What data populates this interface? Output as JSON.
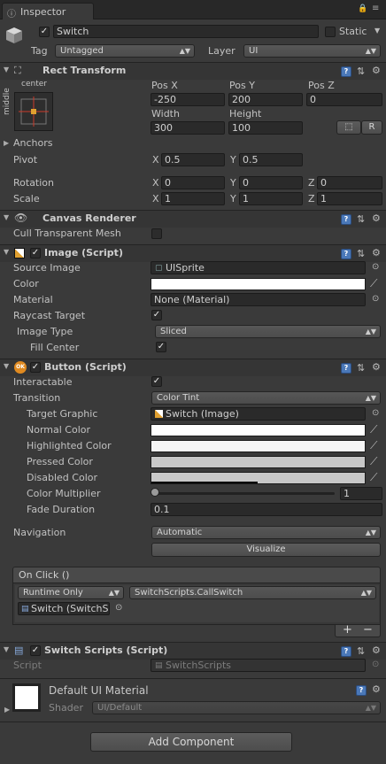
{
  "window": {
    "tab_title": "Inspector"
  },
  "gameobject": {
    "name": "Switch",
    "static_label": "Static",
    "tag_label": "Tag",
    "tag_value": "Untagged",
    "layer_label": "Layer",
    "layer_value": "UI"
  },
  "rect_transform": {
    "title": "Rect Transform",
    "anchor_preset_top": "center",
    "anchor_preset_side": "middle",
    "pos_x_label": "Pos X",
    "pos_y_label": "Pos Y",
    "pos_z_label": "Pos Z",
    "pos_x": "-250",
    "pos_y": "200",
    "pos_z": "0",
    "width_label": "Width",
    "height_label": "Height",
    "width": "300",
    "height": "100",
    "raw_btn": "R",
    "anchors_label": "Anchors",
    "pivot_label": "Pivot",
    "pivot_x": "0.5",
    "pivot_y": "0.5",
    "rotation_label": "Rotation",
    "rot_x": "0",
    "rot_y": "0",
    "rot_z": "0",
    "scale_label": "Scale",
    "scale_x": "1",
    "scale_y": "1",
    "scale_z": "1",
    "x": "X",
    "y": "Y",
    "z": "Z"
  },
  "canvas_renderer": {
    "title": "Canvas Renderer",
    "cull_label": "Cull Transparent Mesh"
  },
  "image": {
    "title": "Image (Script)",
    "source_label": "Source Image",
    "source_value": "UISprite",
    "color_label": "Color",
    "material_label": "Material",
    "material_value": "None (Material)",
    "raycast_label": "Raycast Target",
    "type_label": "Image Type",
    "type_value": "Sliced",
    "fill_label": "Fill Center"
  },
  "button": {
    "title": "Button (Script)",
    "interactable_label": "Interactable",
    "transition_label": "Transition",
    "transition_value": "Color Tint",
    "target_label": "Target Graphic",
    "target_value": "Switch (Image)",
    "normal_label": "Normal Color",
    "highlighted_label": "Highlighted Color",
    "pressed_label": "Pressed Color",
    "disabled_label": "Disabled Color",
    "multiplier_label": "Color Multiplier",
    "multiplier_value": "1",
    "fade_label": "Fade Duration",
    "fade_value": "0.1",
    "navigation_label": "Navigation",
    "navigation_value": "Automatic",
    "visualize_btn": "Visualize",
    "onclick_title": "On Click ()",
    "runtime_value": "Runtime Only",
    "function_value": "SwitchScripts.CallSwitch",
    "object_value": "Switch (SwitchS",
    "plus": "+",
    "minus": "−",
    "ok_badge": "OK"
  },
  "switch_scripts": {
    "title": "Switch Scripts (Script)",
    "script_label": "Script",
    "script_value": "SwitchScripts"
  },
  "material": {
    "name": "Default UI Material",
    "shader_label": "Shader",
    "shader_value": "UI/Default"
  },
  "add_component": "Add Component",
  "colors": {
    "normal": "#ffffff",
    "highlighted": "#f5f5f5",
    "pressed": "#c8c8c8",
    "disabled": "#c8c8c8",
    "image_color": "#ffffff"
  },
  "slider": {
    "color_multiplier_fraction": 0.2
  }
}
